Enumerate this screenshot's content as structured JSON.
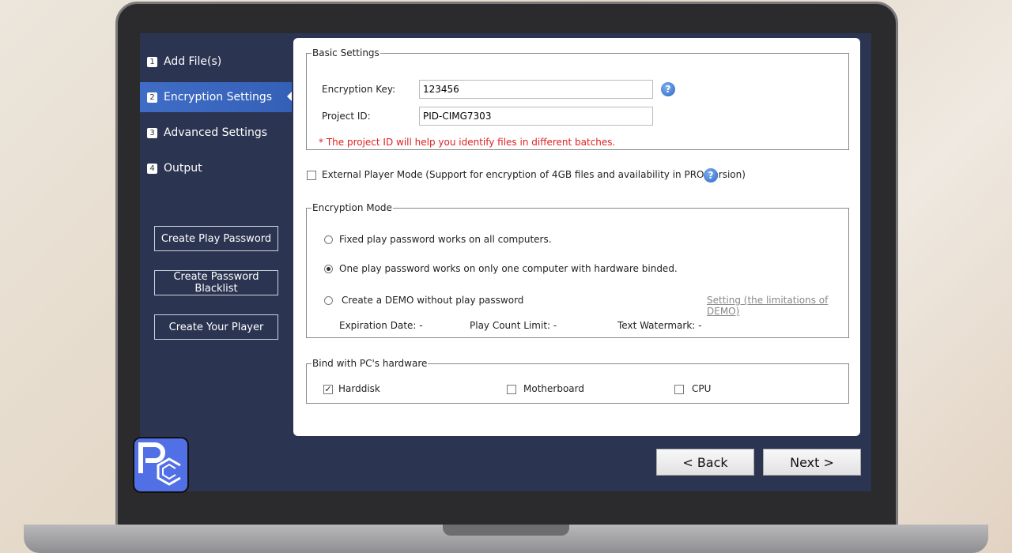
{
  "sidebar": {
    "steps": [
      {
        "num": "1",
        "label": "Add File(s)"
      },
      {
        "num": "2",
        "label": "Encryption Settings"
      },
      {
        "num": "3",
        "label": "Advanced Settings"
      },
      {
        "num": "4",
        "label": "Output"
      }
    ],
    "buttons": [
      "Create Play Password",
      "Create Password Blacklist",
      "Create Your Player"
    ]
  },
  "basic": {
    "legend": "Basic Settings",
    "key_label": "Encryption Key:",
    "key_value": "123456",
    "pid_label": "Project ID:",
    "pid_value": "PID-CIMG7303",
    "note": "* The project ID will help you identify files in different batches."
  },
  "external": {
    "label": "External Player Mode (Support for encryption of 4GB files and availability in PRO version)",
    "checked": false
  },
  "mode": {
    "legend": "Encryption Mode",
    "options": [
      "Fixed play password works on all computers.",
      "One play password works on only one computer with hardware binded.",
      "Create a DEMO without play password"
    ],
    "selected": 1,
    "demo_link": "Setting (the limitations of DEMO)",
    "expiration": "Expiration Date:  -",
    "play_count": "Play Count Limit:  -",
    "watermark": "Text Watermark:  -"
  },
  "hardware": {
    "legend": "Bind with PC's hardware",
    "items": [
      {
        "label": "Harddisk",
        "checked": true
      },
      {
        "label": "Motherboard",
        "checked": false
      },
      {
        "label": "CPU",
        "checked": false
      }
    ]
  },
  "nav": {
    "back": "< Back",
    "next": "Next >"
  },
  "help_glyph": "?",
  "check_glyph": "✓",
  "logo_text": "PC"
}
